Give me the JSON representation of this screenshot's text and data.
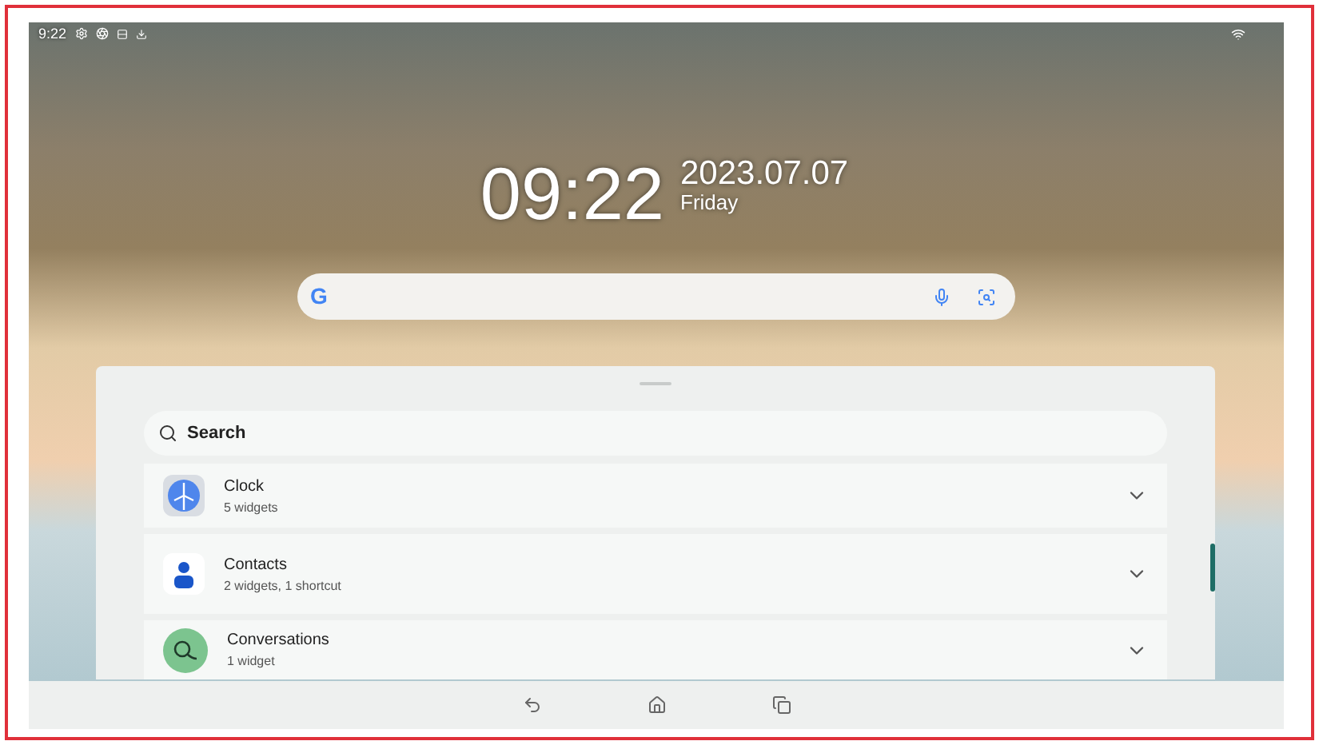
{
  "status_bar": {
    "time": "9:22"
  },
  "clock_widget": {
    "time": "09:22",
    "date": "2023.07.07",
    "weekday": "Friday"
  },
  "search_bar": {
    "logo": "G"
  },
  "widget_sheet": {
    "search": {
      "placeholder": "Search"
    },
    "apps": [
      {
        "name": "Clock",
        "summary": "5 widgets",
        "kind": "clock",
        "expanded": false
      },
      {
        "name": "Contacts",
        "summary": "2 widgets, 1 shortcut",
        "kind": "contacts",
        "expanded": false
      },
      {
        "name": "Conversations",
        "summary": "1 widget",
        "kind": "conversations",
        "expanded": false
      }
    ]
  }
}
